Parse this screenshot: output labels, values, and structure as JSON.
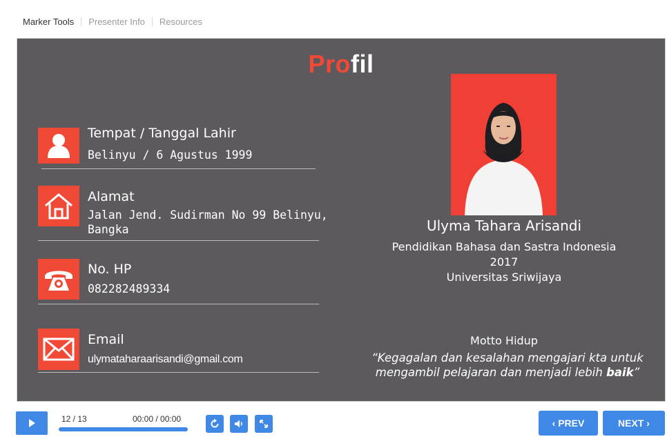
{
  "tabs": [
    {
      "label": "Marker Tools",
      "active": true
    },
    {
      "label": "Presenter Info",
      "active": false
    },
    {
      "label": "Resources",
      "active": false
    }
  ],
  "slide": {
    "title_part1": "Pro",
    "title_part2": "fil",
    "birth": {
      "label": "Tempat / Tanggal Lahir",
      "value": "Belinyu / 6 Agustus 1999",
      "icon": "person-icon"
    },
    "address": {
      "label": "Alamat",
      "value_line1": "Jalan Jend. Sudirman No 99 Belinyu,",
      "value_line2": "Bangka",
      "icon": "home-icon"
    },
    "phone": {
      "label": "No. HP",
      "value": "082282489334",
      "icon": "telephone-icon"
    },
    "email": {
      "label": "Email",
      "value": "ulymataharaarisandi@gmail.com",
      "icon": "envelope-icon"
    },
    "person": {
      "name": "Ulyma Tahara Arisandi",
      "program": "Pendidikan Bahasa dan Sastra Indonesia",
      "year": "2017",
      "university": "Universitas Sriwijaya"
    },
    "motto": {
      "title": "Motto Hidup",
      "line1": "“Kegagalan dan kesalahan mengajari kta untuk",
      "line2": "mengambil pelajaran dan menjadi lebih ",
      "emphasis": "baik",
      "closing": "”"
    }
  },
  "player": {
    "slide_counter": "12 / 13",
    "time": "00:00 / 00:00",
    "progress_fraction": 1.0,
    "prev_label": "PREV",
    "next_label": "NEXT",
    "prev_chevron": "‹",
    "next_chevron": "›"
  },
  "colors": {
    "accent": "#3f88e6",
    "slide_bg": "#5d5a5e",
    "brand_red": "#f04a37"
  }
}
